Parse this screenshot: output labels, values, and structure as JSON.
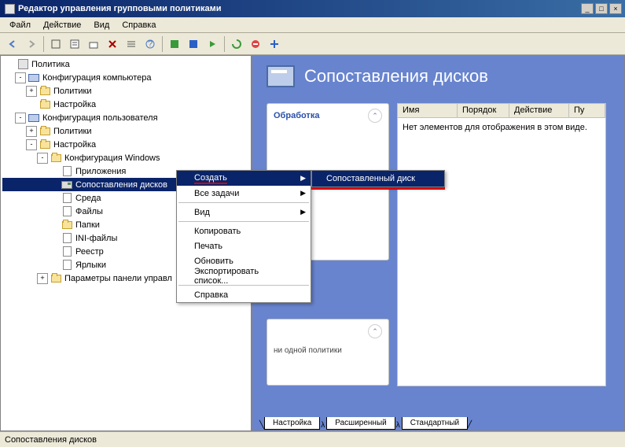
{
  "window": {
    "title": "Редактор управления групповыми политиками"
  },
  "menubar": [
    "Файл",
    "Действие",
    "Вид",
    "Справка"
  ],
  "tree": [
    {
      "lvl": 0,
      "tw": "",
      "icon": "root",
      "label": "Политика"
    },
    {
      "lvl": 1,
      "tw": "-",
      "icon": "comp",
      "label": "Конфигурация компьютера"
    },
    {
      "lvl": 2,
      "tw": "+",
      "icon": "folder",
      "label": "Политики"
    },
    {
      "lvl": 2,
      "tw": "",
      "icon": "folder",
      "label": "Настройка"
    },
    {
      "lvl": 1,
      "tw": "-",
      "icon": "comp",
      "label": "Конфигурация пользователя"
    },
    {
      "lvl": 2,
      "tw": "+",
      "icon": "folder",
      "label": "Политики"
    },
    {
      "lvl": 2,
      "tw": "-",
      "icon": "folder",
      "label": "Настройка"
    },
    {
      "lvl": 3,
      "tw": "-",
      "icon": "folder",
      "label": "Конфигурация Windows"
    },
    {
      "lvl": 4,
      "tw": "",
      "icon": "file",
      "label": "Приложения"
    },
    {
      "lvl": 4,
      "tw": "",
      "icon": "disk",
      "label": "Сопоставления дисков",
      "sel": true
    },
    {
      "lvl": 4,
      "tw": "",
      "icon": "file",
      "label": "Среда"
    },
    {
      "lvl": 4,
      "tw": "",
      "icon": "file",
      "label": "Файлы"
    },
    {
      "lvl": 4,
      "tw": "",
      "icon": "folder",
      "label": "Папки"
    },
    {
      "lvl": 4,
      "tw": "",
      "icon": "file",
      "label": "INI-файлы"
    },
    {
      "lvl": 4,
      "tw": "",
      "icon": "file",
      "label": "Реестр"
    },
    {
      "lvl": 4,
      "tw": "",
      "icon": "file",
      "label": "Ярлыки"
    },
    {
      "lvl": 3,
      "tw": "+",
      "icon": "folder",
      "label": "Параметры панели управл"
    }
  ],
  "right": {
    "title": "Сопоставления дисков",
    "proc": "Обработка",
    "cols": [
      "Имя",
      "Порядок",
      "Действие",
      "Пу"
    ],
    "empty": "Нет элементов для отображения в этом виде.",
    "desc_body": "ни одной политики"
  },
  "context": {
    "items": [
      {
        "label": "Создать",
        "arrow": true,
        "hl": true
      },
      {
        "label": "Все задачи",
        "arrow": true
      },
      {
        "sep": true
      },
      {
        "label": "Вид",
        "arrow": true
      },
      {
        "sep": true
      },
      {
        "label": "Копировать"
      },
      {
        "label": "Печать"
      },
      {
        "label": "Обновить"
      },
      {
        "label": "Экспортировать список..."
      },
      {
        "sep": true
      },
      {
        "label": "Справка"
      }
    ],
    "submenu": "Сопоставленный диск"
  },
  "tabs": [
    "Настройка",
    "Расширенный",
    "Стандартный"
  ],
  "statusbar": "Сопоставления дисков"
}
